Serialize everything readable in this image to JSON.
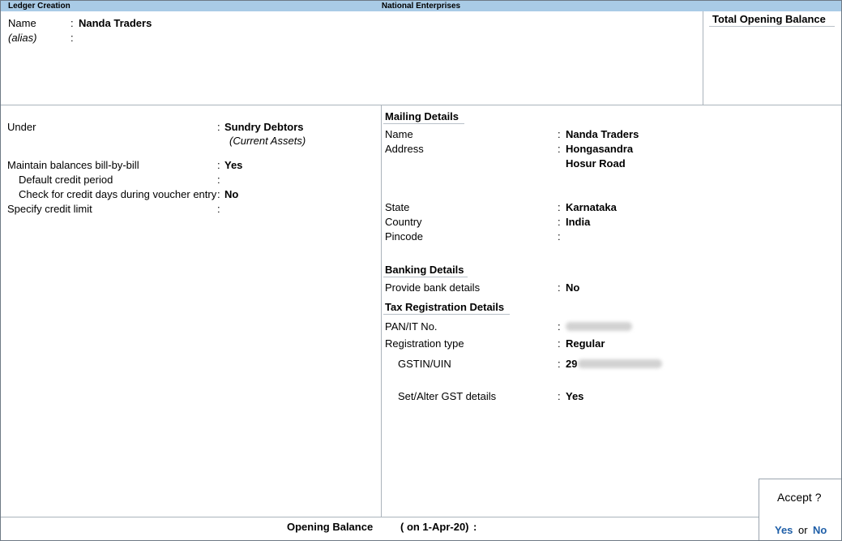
{
  "title_bar": {
    "screen": "Ledger Creation",
    "company": "National Enterprises"
  },
  "header": {
    "name_label": "Name",
    "name_value": "Nanda Traders",
    "alias_label": "(alias)",
    "alias_value": "",
    "opening_total_label": "Total Opening Balance"
  },
  "left_panel": {
    "under_label": "Under",
    "under_value": "Sundry Debtors",
    "under_sub": "(Current Assets)",
    "billwise_label": "Maintain balances bill-by-bill",
    "billwise_value": "Yes",
    "credit_period_label": "Default credit period",
    "credit_period_value": "",
    "credit_check_label": "Check for credit days during voucher entry",
    "credit_check_value": "No",
    "credit_limit_label": "Specify credit limit",
    "credit_limit_value": ""
  },
  "mailing": {
    "heading": "Mailing Details",
    "name_label": "Name",
    "name_value": "Nanda Traders",
    "address_label": "Address",
    "address_line1": "Hongasandra",
    "address_line2": "Hosur Road",
    "state_label": "State",
    "state_value": "Karnataka",
    "country_label": "Country",
    "country_value": "India",
    "pincode_label": "Pincode",
    "pincode_value": ""
  },
  "banking": {
    "heading": "Banking Details",
    "bank_label": "Provide bank details",
    "bank_value": "No"
  },
  "tax": {
    "heading": "Tax Registration Details",
    "pan_label": "PAN/IT No.",
    "regtype_label": "Registration type",
    "regtype_value": "Regular",
    "gstin_label": "GSTIN/UIN",
    "gstin_prefix": "29",
    "gst_details_label": "Set/Alter GST details",
    "gst_details_value": "Yes"
  },
  "footer": {
    "opening_label": "Opening Balance",
    "opening_date": "( on 1-Apr-20)",
    "colon": ":"
  },
  "accept_dialog": {
    "prompt": "Accept ?",
    "yes": "Yes",
    "or": "or",
    "no": "No"
  },
  "sep": ":"
}
